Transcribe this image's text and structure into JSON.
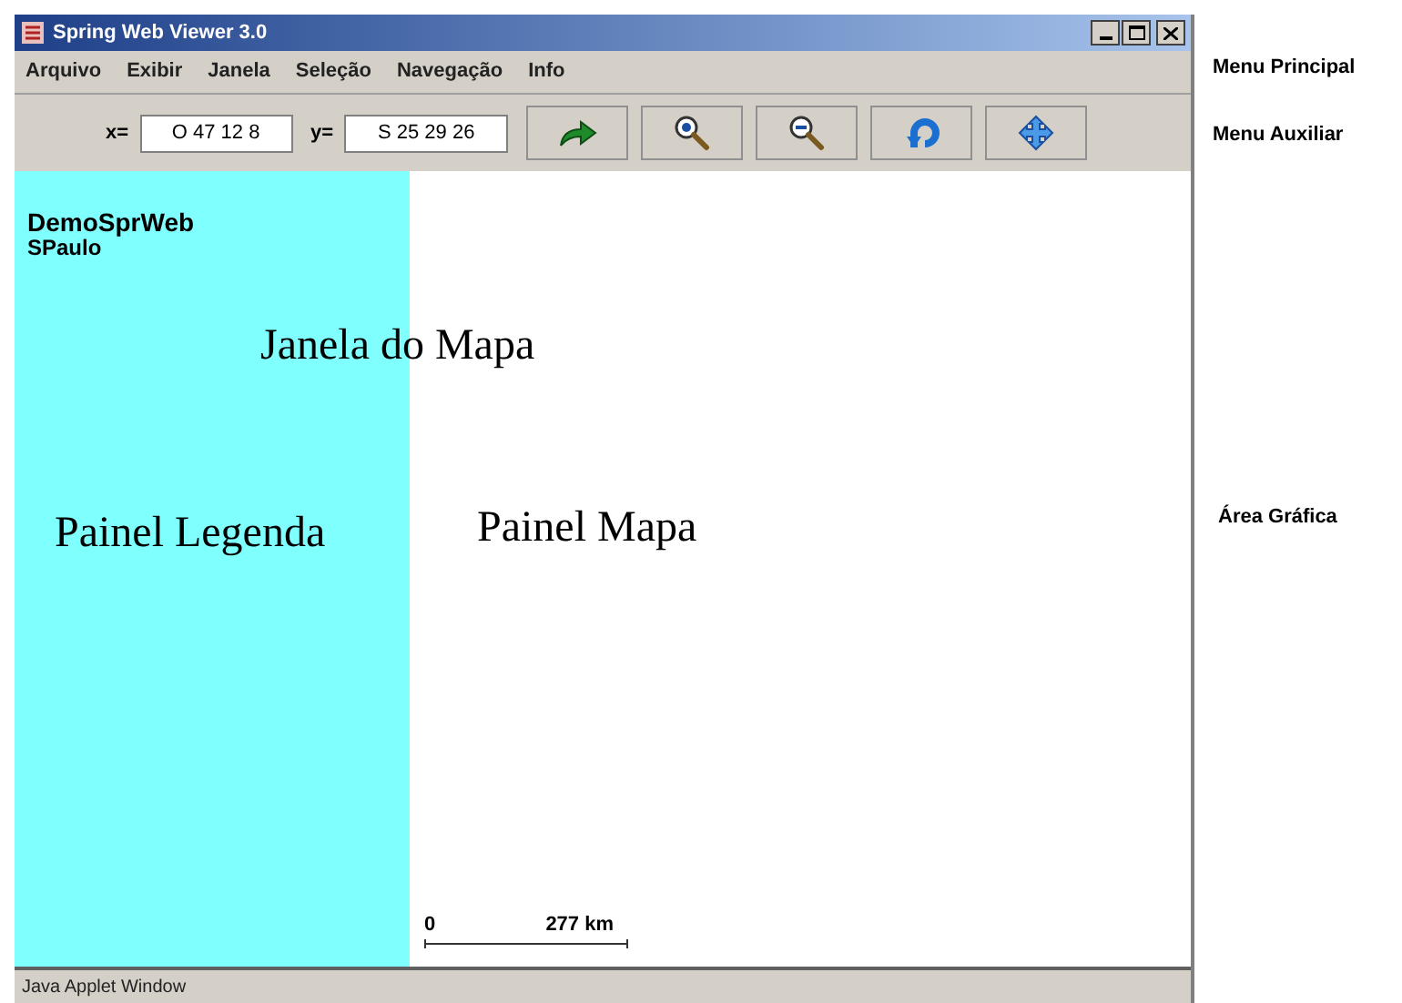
{
  "window": {
    "title": "Spring Web Viewer 3.0"
  },
  "menu": [
    "Arquivo",
    "Exibir",
    "Janela",
    "Seleção",
    "Navegação",
    "Info"
  ],
  "toolbar": {
    "x_label": "x=",
    "x_value": "O 47 12 8",
    "y_label": "y=",
    "y_value": "S 25 29 26",
    "buttons": [
      {
        "kind": "go"
      },
      {
        "kind": "zoom-in"
      },
      {
        "kind": "zoom-out"
      },
      {
        "kind": "undo"
      },
      {
        "kind": "pan"
      }
    ]
  },
  "legend_panel": {
    "title": "DemoSprWeb",
    "subtitle": "SPaulo",
    "caption": "Painel Legenda"
  },
  "map_panel": {
    "caption": "Painel Mapa",
    "scale_start": "0",
    "scale_end": "277 km"
  },
  "overlay_caption": "Janela do Mapa",
  "status_bar": "Java Applet Window",
  "annotations": [
    "Menu Principal",
    "Menu Auxiliar",
    "Área Gráfica"
  ]
}
